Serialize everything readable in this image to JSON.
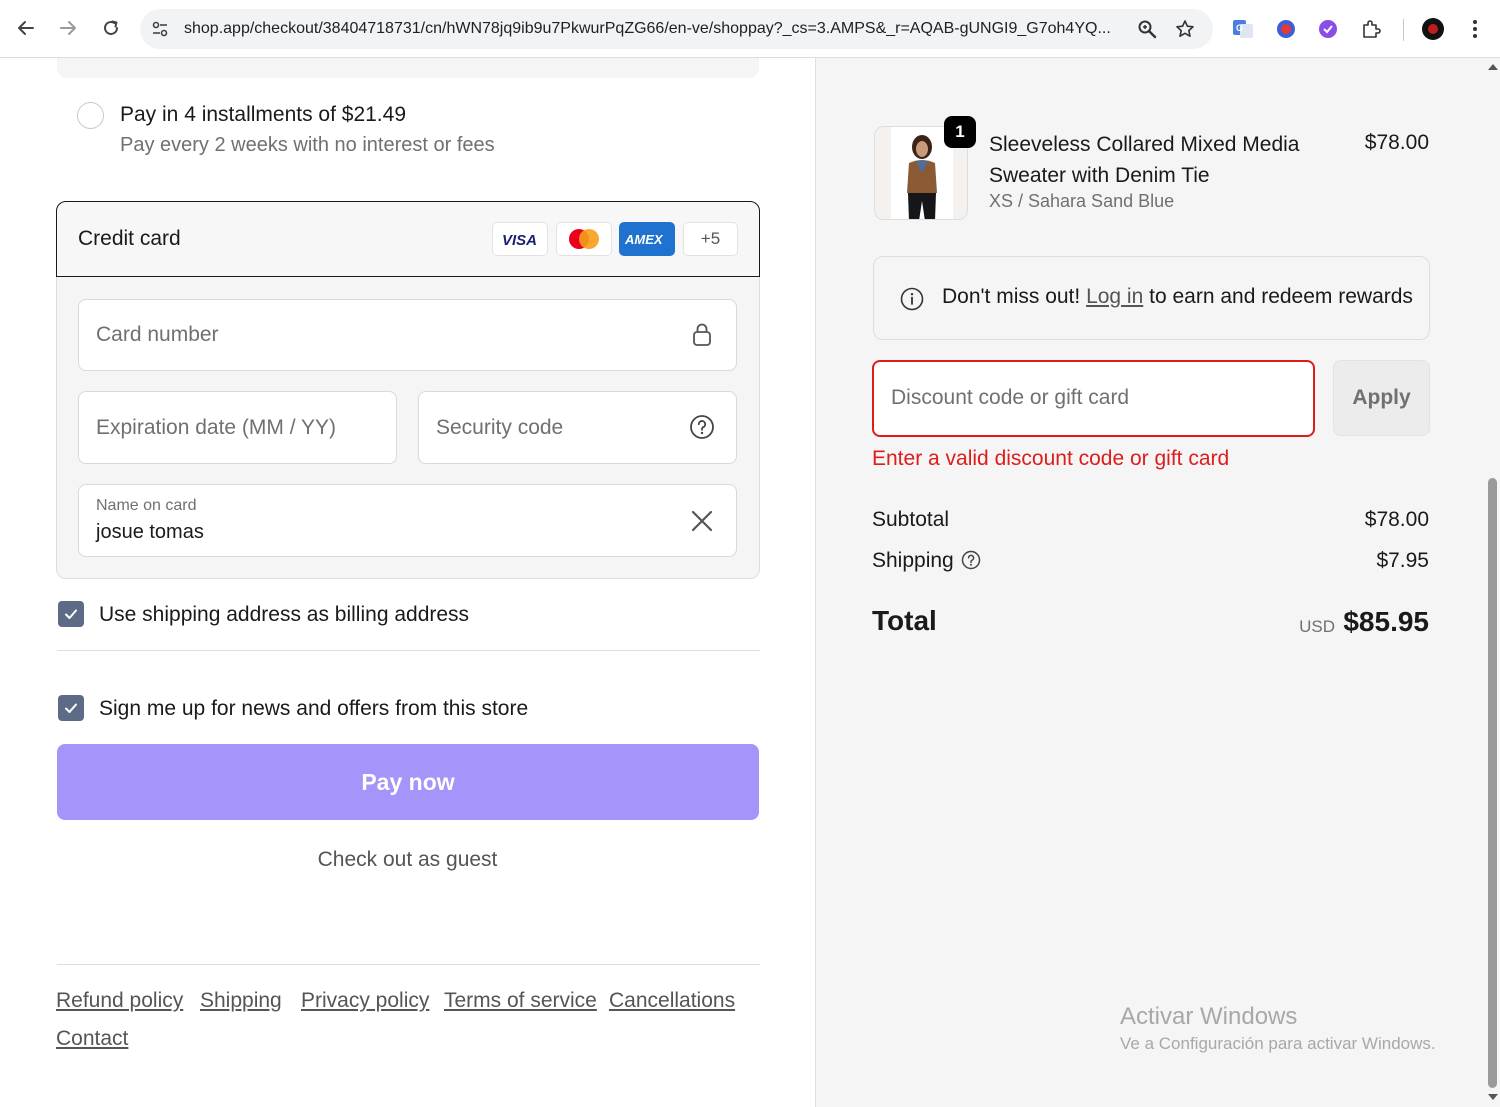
{
  "browser": {
    "url": "shop.app/checkout/38404718731/cn/hWN78jq9ib9u7PkwurPqZG66/en-ve/shoppay?_cs=3.AMPS&_r=AQAB-gUNGI9_G7oh4YQ..."
  },
  "payment": {
    "installments_title": "Pay in 4 installments of $21.49",
    "installments_subtitle": "Pay every 2 weeks with no interest or fees",
    "credit_card_title": "Credit card",
    "card_brands": [
      "VISA",
      "Mastercard",
      "AMEX"
    ],
    "more_brands": "+5",
    "card_number_placeholder": "Card number",
    "expiration_placeholder": "Expiration date (MM / YY)",
    "security_code_placeholder": "Security code",
    "name_on_card_label": "Name on card",
    "name_on_card_value": "josue tomas"
  },
  "options": {
    "billing_same": "Use shipping address as billing address",
    "newsletter": "Sign me up for news and offers from this store"
  },
  "actions": {
    "pay_now": "Pay now",
    "guest_checkout": "Check out as guest"
  },
  "footer": {
    "links": [
      "Refund policy",
      "Shipping",
      "Privacy policy",
      "Terms of service",
      "Cancellations",
      "Contact"
    ]
  },
  "summary": {
    "product_name": "Sleeveless Collared Mixed Media Sweater with Denim Tie",
    "product_variant": "XS / Sahara Sand Blue",
    "product_price": "$78.00",
    "quantity": "1",
    "rewards_before": "Don't miss out! ",
    "rewards_link": "Log in",
    "rewards_after": " to earn and redeem rewards",
    "discount_placeholder": "Discount code or gift card",
    "apply_label": "Apply",
    "discount_error": "Enter a valid discount code or gift card",
    "subtotal_label": "Subtotal",
    "subtotal_value": "$78.00",
    "shipping_label": "Shipping",
    "shipping_value": "$7.95",
    "total_label": "Total",
    "total_currency": "USD",
    "total_value": "$85.95"
  },
  "watermark": {
    "title": "Activar Windows",
    "subtitle": "Ve a Configuración para activar Windows."
  },
  "colors": {
    "pay_button": "#a594f9",
    "error": "#dd1d1d",
    "checkbox": "#5d6b86"
  }
}
